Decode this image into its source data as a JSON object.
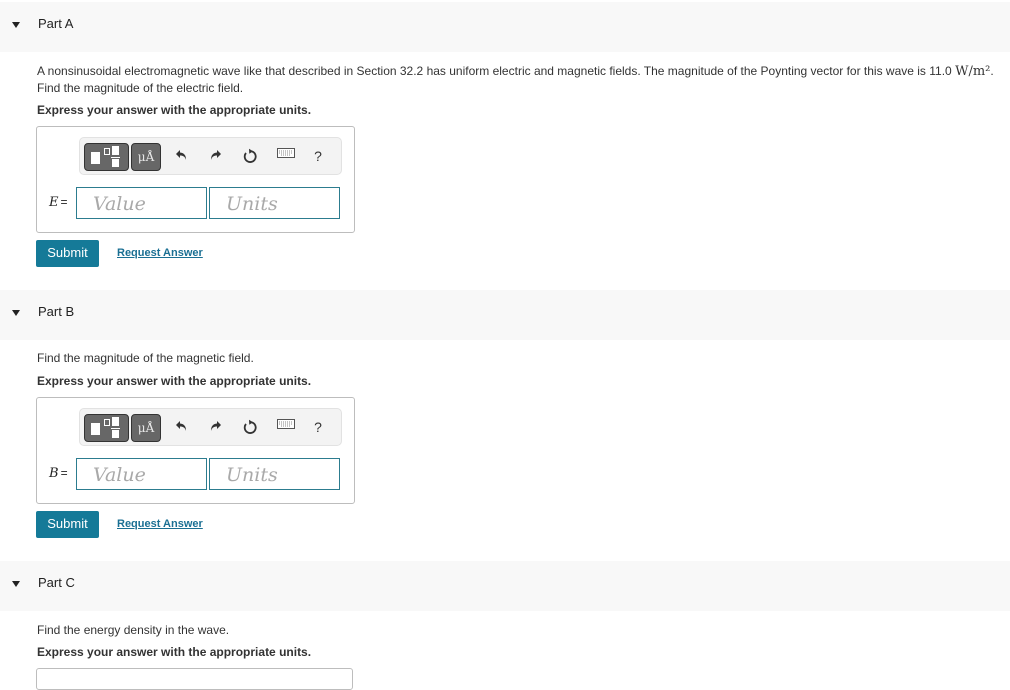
{
  "parts": [
    {
      "title": "Part A",
      "question": "A nonsinusoidal electromagnetic wave like that described in Section 32.2 has uniform electric and magnetic fields. The magnitude of the Poynting vector for this wave is 11.0 ",
      "question_unit": "W/m²",
      "question_tail": ". Find the magnitude of the electric field.",
      "instruction": "Express your answer with the appropriate units.",
      "variable": "E",
      "equals": "=",
      "value_placeholder": "Value",
      "units_placeholder": "Units",
      "submit_label": "Submit",
      "request_answer_label": "Request Answer"
    },
    {
      "title": "Part B",
      "question": "Find the magnitude of the magnetic field.",
      "instruction": "Express your answer with the appropriate units.",
      "variable": "B",
      "equals": "=",
      "value_placeholder": "Value",
      "units_placeholder": "Units",
      "submit_label": "Submit",
      "request_answer_label": "Request Answer"
    },
    {
      "title": "Part C",
      "question": "Find the energy density in the wave.",
      "instruction": "Express your answer with the appropriate units."
    }
  ],
  "toolbar": {
    "units_button_label": "μÅ",
    "help_label": "?",
    "icons": [
      "templates-icon",
      "units-icon",
      "undo-icon",
      "redo-icon",
      "reset-icon",
      "keyboard-icon",
      "help-icon"
    ]
  },
  "colors": {
    "accent": "#157a98",
    "link": "#1a6f93",
    "field_border": "#2c7c8f",
    "header_bg": "#f8f8f8"
  }
}
